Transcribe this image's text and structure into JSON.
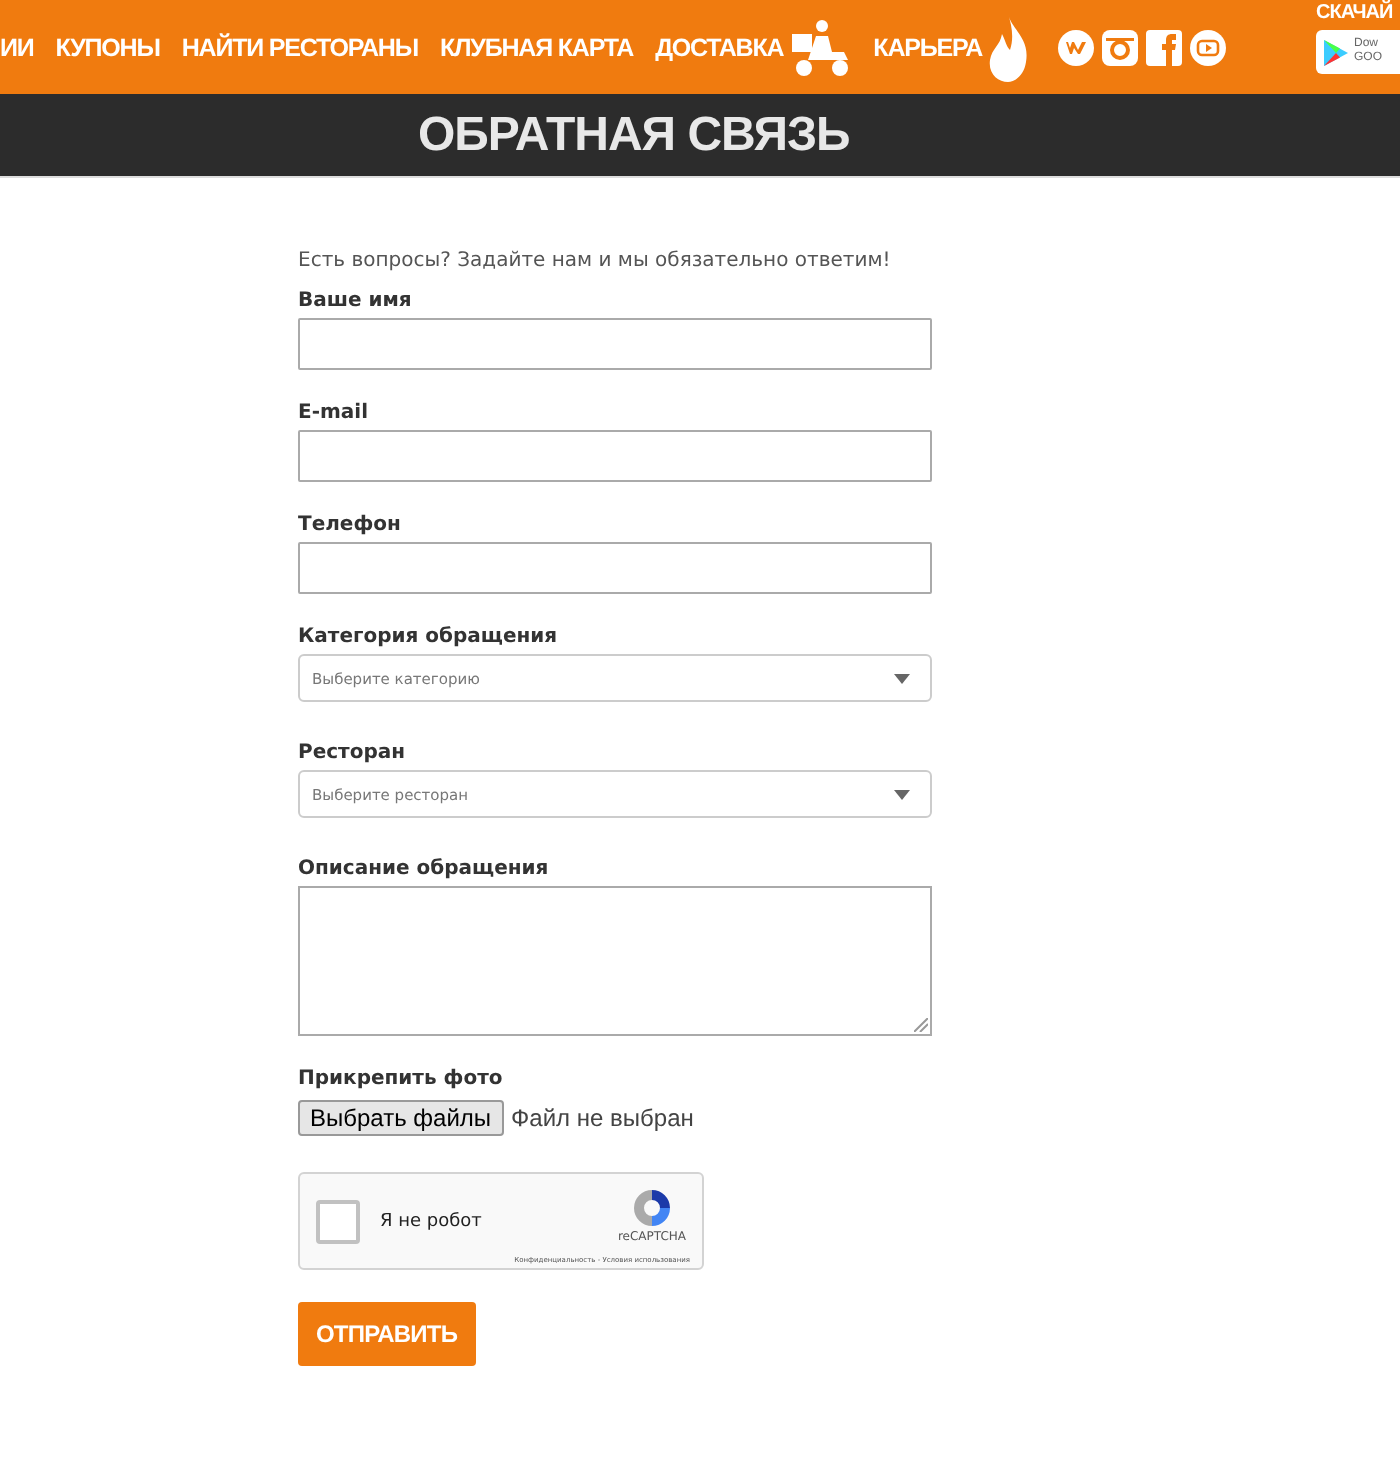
{
  "nav": {
    "items": [
      {
        "label": "ИИ"
      },
      {
        "label": "КУПОНЫ"
      },
      {
        "label": "НАЙТИ РЕСТОРАНЫ"
      },
      {
        "label": "КЛУБНАЯ КАРТА"
      },
      {
        "label": "ДОСТАВКА"
      },
      {
        "label": "КАРЬЕРА"
      }
    ],
    "download_title": "СКАЧАЙ",
    "badge_lines": [
      "Dow",
      "GOO"
    ]
  },
  "page_title": "ОБРАТНАЯ СВЯЗЬ",
  "form": {
    "intro": "Есть вопросы? Задайте нам и мы обязательно ответим!",
    "fields": [
      {
        "kind": "text",
        "label": "Ваше имя"
      },
      {
        "kind": "text",
        "label": "E-mail"
      },
      {
        "kind": "text",
        "label": "Телефон"
      },
      {
        "kind": "select",
        "label": "Категория обращения",
        "placeholder": "Выберите категорию"
      },
      {
        "kind": "select",
        "label": "Ресторан",
        "placeholder": "Выберите ресторан"
      },
      {
        "kind": "textarea",
        "label": "Описание обращения"
      },
      {
        "kind": "file",
        "label": "Прикрепить фото",
        "button": "Выбрать файлы",
        "status": "Файл не выбран"
      }
    ],
    "captcha": {
      "label": "Я не робот",
      "checked": false,
      "brand": "reCAPTCHA",
      "links": "Конфиденциальность - Условия использования"
    },
    "submit": "ОТПРАВИТЬ"
  }
}
